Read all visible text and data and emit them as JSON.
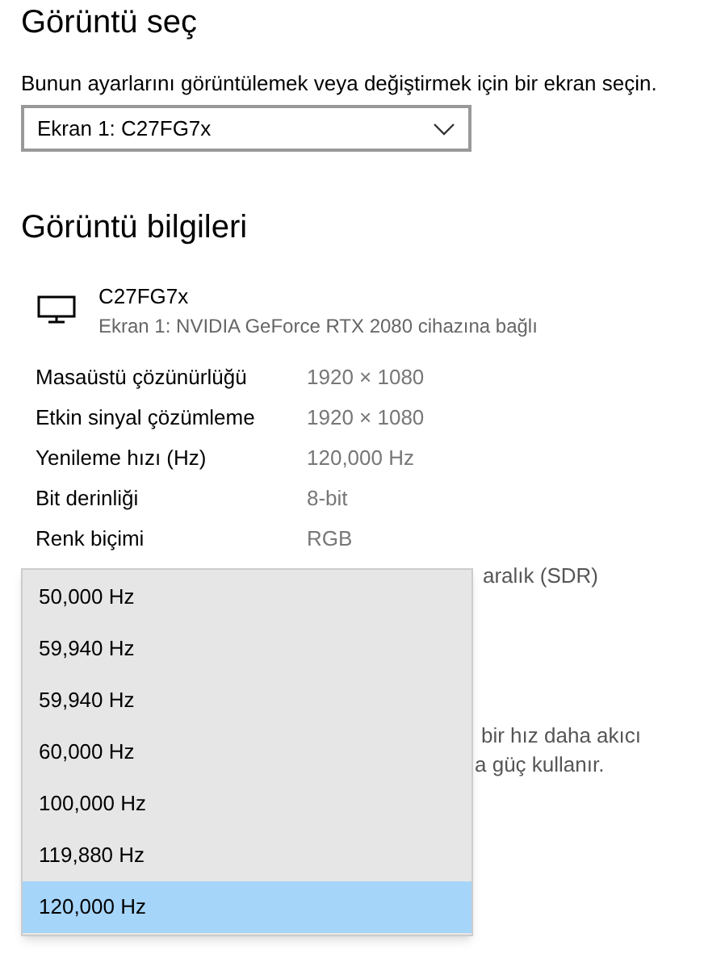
{
  "select_display": {
    "title": "Görüntü seç",
    "description": "Bunun ayarlarını görüntülemek veya değiştirmek için bir ekran seçin.",
    "dropdown": {
      "value": "Ekran 1: C27FG7x"
    }
  },
  "display_info": {
    "title": "Görüntü bilgileri",
    "monitor": {
      "name": "C27FG7x",
      "subtitle": "Ekran 1: NVIDIA GeForce RTX 2080 cihazına bağlı"
    },
    "rows": [
      {
        "label": "Masaüstü çözünürlüğü",
        "value": "1920 × 1080"
      },
      {
        "label": "Etkin sinyal çözümleme",
        "value": "1920 × 1080"
      },
      {
        "label": "Yenileme hızı (Hz)",
        "value": "120,000 Hz"
      },
      {
        "label": "Bit derinliği",
        "value": "8-bit"
      },
      {
        "label": "Renk biçimi",
        "value": "RGB"
      }
    ],
    "partial_texts": [
      "aralık (SDR)",
      "bir hız daha akıcı",
      "a güç kullanır."
    ]
  },
  "refresh_menu": [
    {
      "label": "50,000 Hz",
      "selected": false
    },
    {
      "label": "59,940 Hz",
      "selected": false
    },
    {
      "label": "59,940 Hz",
      "selected": false
    },
    {
      "label": "60,000 Hz",
      "selected": false
    },
    {
      "label": "100,000 Hz",
      "selected": false
    },
    {
      "label": "119,880 Hz",
      "selected": false
    },
    {
      "label": "120,000 Hz",
      "selected": true
    }
  ]
}
